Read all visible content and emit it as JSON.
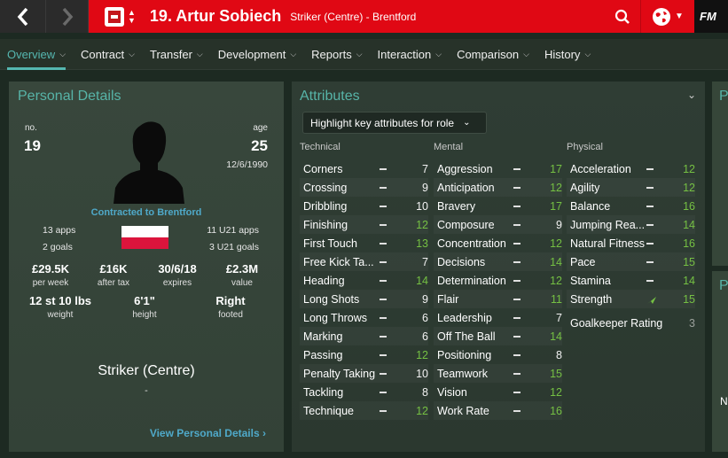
{
  "header": {
    "back_icon": "chevron-left-icon",
    "forward_icon": "chevron-right-icon",
    "player_title": "19. Artur Sobiech",
    "player_subtitle": "Striker (Centre) - Brentford",
    "logo_text": "FM",
    "accent_color": "#e00814"
  },
  "tabs": [
    {
      "label": "Overview"
    },
    {
      "label": "Contract"
    },
    {
      "label": "Transfer"
    },
    {
      "label": "Development"
    },
    {
      "label": "Reports"
    },
    {
      "label": "Interaction"
    },
    {
      "label": "Comparison"
    },
    {
      "label": "History"
    }
  ],
  "personal": {
    "title": "Personal Details",
    "no_label": "no.",
    "no_value": "19",
    "age_label": "age",
    "age_value": "25",
    "dob": "12/6/1990",
    "contracted": "Contracted to Brentford",
    "apps": "13 apps",
    "goals": "2 goals",
    "u21_apps": "11 U21 apps",
    "u21_goals": "3 U21 goals",
    "wage_value": "£29.5K",
    "wage_label": "per week",
    "after_tax_value": "£16K",
    "after_tax_label": "after tax",
    "expires_value": "30/6/18",
    "expires_label": "expires",
    "value_value": "£2.3M",
    "value_label": "value",
    "weight_value": "12 st 10 lbs",
    "weight_label": "weight",
    "height_value": "6'1\"",
    "height_label": "height",
    "foot_value": "Right",
    "foot_label": "footed",
    "position": "Striker (Centre)",
    "position_sub": "-",
    "view_link": "View Personal Details"
  },
  "attributes": {
    "title": "Attributes",
    "highlight_label": "Highlight key attributes for role",
    "technical_header": "Technical",
    "mental_header": "Mental",
    "physical_header": "Physical",
    "technical": [
      {
        "name": "Corners",
        "value": "7",
        "color": "w"
      },
      {
        "name": "Crossing",
        "value": "9",
        "color": "w"
      },
      {
        "name": "Dribbling",
        "value": "10",
        "color": "w"
      },
      {
        "name": "Finishing",
        "value": "12",
        "color": "g"
      },
      {
        "name": "First Touch",
        "value": "13",
        "color": "g"
      },
      {
        "name": "Free Kick Ta...",
        "value": "7",
        "color": "w"
      },
      {
        "name": "Heading",
        "value": "14",
        "color": "g"
      },
      {
        "name": "Long Shots",
        "value": "9",
        "color": "w"
      },
      {
        "name": "Long Throws",
        "value": "6",
        "color": "w"
      },
      {
        "name": "Marking",
        "value": "6",
        "color": "w"
      },
      {
        "name": "Passing",
        "value": "12",
        "color": "g"
      },
      {
        "name": "Penalty Taking",
        "value": "10",
        "color": "w"
      },
      {
        "name": "Tackling",
        "value": "8",
        "color": "w"
      },
      {
        "name": "Technique",
        "value": "12",
        "color": "g"
      }
    ],
    "mental": [
      {
        "name": "Aggression",
        "value": "17",
        "color": "g"
      },
      {
        "name": "Anticipation",
        "value": "12",
        "color": "g"
      },
      {
        "name": "Bravery",
        "value": "17",
        "color": "g"
      },
      {
        "name": "Composure",
        "value": "9",
        "color": "w"
      },
      {
        "name": "Concentration",
        "value": "12",
        "color": "g"
      },
      {
        "name": "Decisions",
        "value": "14",
        "color": "g"
      },
      {
        "name": "Determination",
        "value": "12",
        "color": "g"
      },
      {
        "name": "Flair",
        "value": "11",
        "color": "g"
      },
      {
        "name": "Leadership",
        "value": "7",
        "color": "w"
      },
      {
        "name": "Off The Ball",
        "value": "14",
        "color": "g"
      },
      {
        "name": "Positioning",
        "value": "8",
        "color": "w"
      },
      {
        "name": "Teamwork",
        "value": "15",
        "color": "g"
      },
      {
        "name": "Vision",
        "value": "12",
        "color": "g"
      },
      {
        "name": "Work Rate",
        "value": "16",
        "color": "g"
      }
    ],
    "physical": [
      {
        "name": "Acceleration",
        "value": "12",
        "color": "g"
      },
      {
        "name": "Agility",
        "value": "12",
        "color": "g"
      },
      {
        "name": "Balance",
        "value": "16",
        "color": "g"
      },
      {
        "name": "Jumping Rea...",
        "value": "14",
        "color": "g"
      },
      {
        "name": "Natural Fitness",
        "value": "16",
        "color": "g"
      },
      {
        "name": "Pace",
        "value": "15",
        "color": "g"
      },
      {
        "name": "Stamina",
        "value": "14",
        "color": "g"
      },
      {
        "name": "Strength",
        "value": "15",
        "color": "g",
        "trend": "up"
      }
    ],
    "goalkeeper_label": "Goalkeeper Rating",
    "goalkeeper_value": "3"
  },
  "side_panels": {
    "top_letter": "P",
    "mid_letter": "P",
    "bottom_letter": "N"
  }
}
